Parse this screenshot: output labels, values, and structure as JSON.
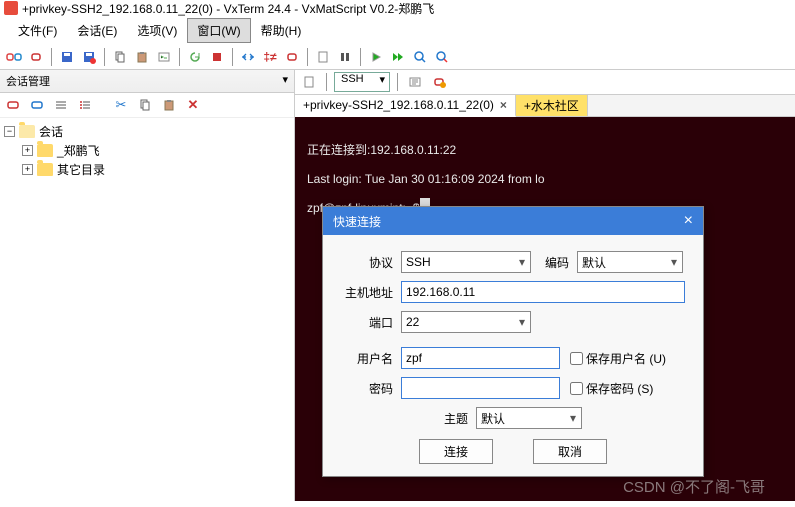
{
  "window": {
    "title": "+privkey-SSH2_192.168.0.11_22(0) - VxTerm 24.4 - VxMatScript V0.2-郑鹏飞"
  },
  "menu": {
    "file": "文件(F)",
    "session": "会话(E)",
    "options": "选项(V)",
    "window": "窗口(W)",
    "help": "帮助(H)"
  },
  "sidebar": {
    "title": "会话管理",
    "root": "会话",
    "child1": "_郑鹏飞",
    "child2": "其它目录"
  },
  "tabs": {
    "active": "+privkey-SSH2_192.168.0.11_22(0)",
    "other": "+水木社区"
  },
  "toolbar2": {
    "proto": "SSH"
  },
  "terminal": {
    "line1": "正在连接到:192.168.0.11:22",
    "line2": "Last login: Tue Jan 30 01:16:09 2024 from lo",
    "line3": "zpf@zpf-linuxmint:~$"
  },
  "dialog": {
    "title": "快速连接",
    "labels": {
      "proto": "协议",
      "encoding": "编码",
      "host": "主机地址",
      "port": "端口",
      "user": "用户名",
      "pass": "密码",
      "theme": "主题"
    },
    "values": {
      "proto": "SSH",
      "encoding": "默认",
      "host": "192.168.0.11",
      "port": "22",
      "user": "zpf",
      "pass": "",
      "theme": "默认"
    },
    "checks": {
      "save_user": "保存用户名 (U)",
      "save_pass": "保存密码 (S)"
    },
    "buttons": {
      "connect": "连接",
      "cancel": "取消"
    }
  },
  "watermark": "CSDN @不了阁-飞哥"
}
